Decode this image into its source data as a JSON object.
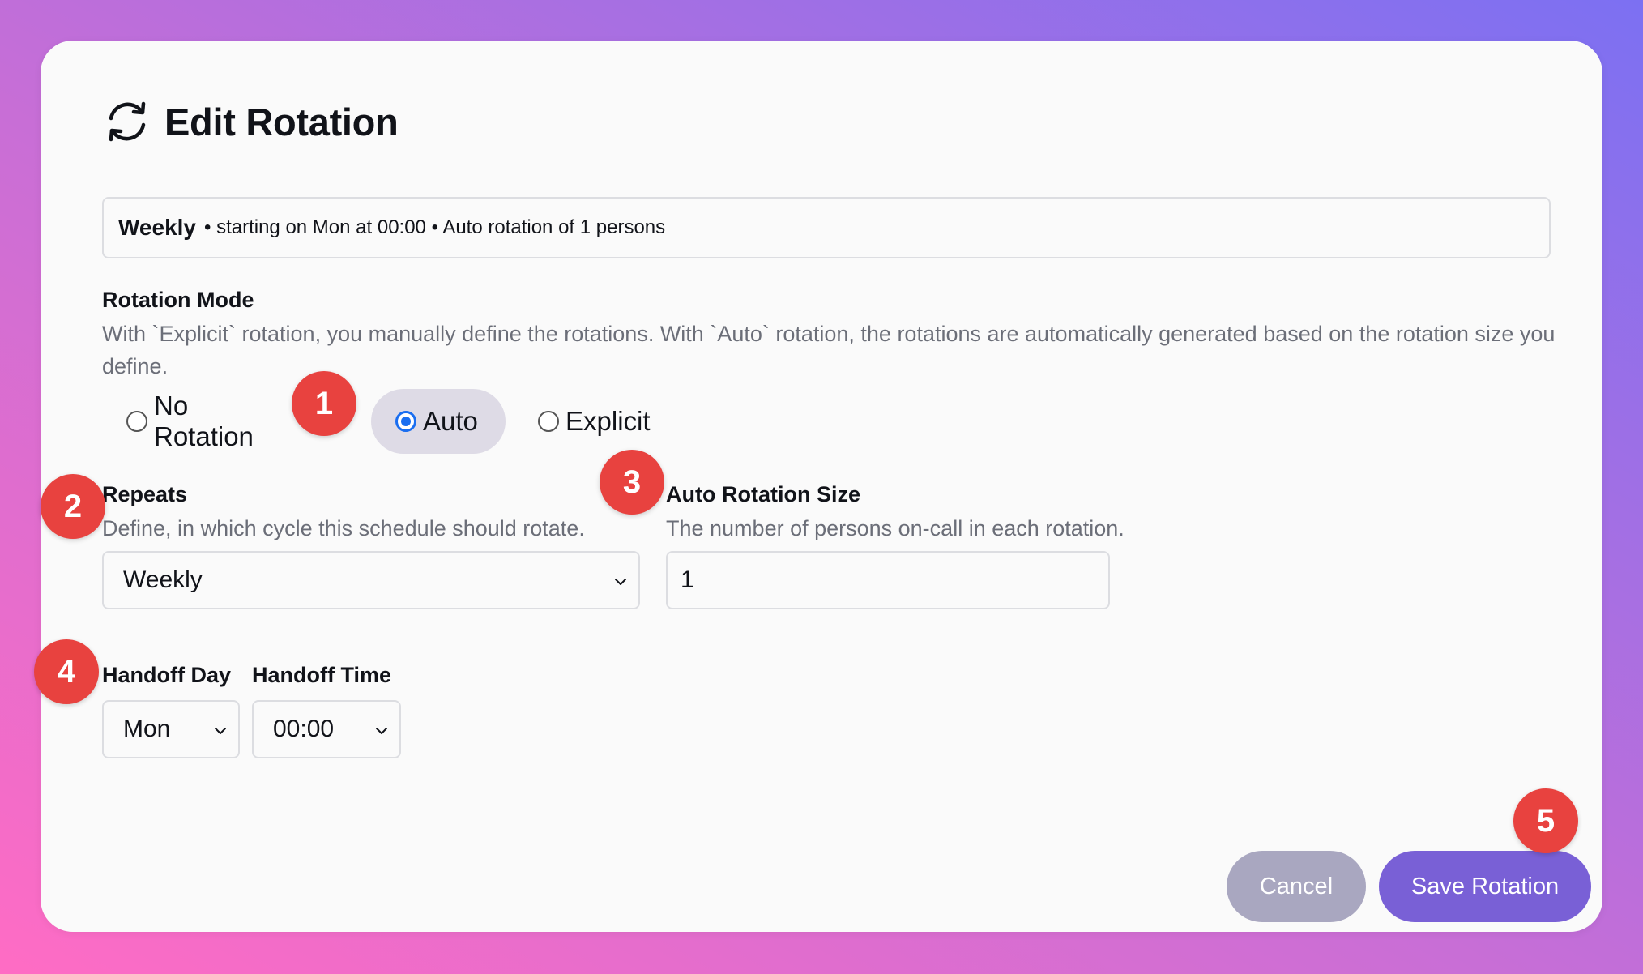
{
  "dialog": {
    "title": "Edit Rotation",
    "icon": "refresh-icon"
  },
  "summary": {
    "frequency": "Weekly",
    "details": "• starting on Mon at 00:00 • Auto rotation of 1 persons"
  },
  "rotation_mode": {
    "label": "Rotation Mode",
    "description": "With `Explicit` rotation, you manually define the rotations. With `Auto` rotation, the rotations are automatically generated based on the rotation size you define.",
    "options": [
      {
        "label": "No Rotation",
        "selected": false
      },
      {
        "label": "Auto",
        "selected": true
      },
      {
        "label": "Explicit",
        "selected": false
      }
    ]
  },
  "repeats": {
    "label": "Repeats",
    "description": "Define, in which cycle this schedule should rotate.",
    "value": "Weekly"
  },
  "auto_rotation_size": {
    "label": "Auto Rotation Size",
    "description": "The number of persons on-call in each rotation.",
    "value": "1"
  },
  "handoff_day": {
    "label": "Handoff Day",
    "value": "Mon"
  },
  "handoff_time": {
    "label": "Handoff Time",
    "value": "00:00"
  },
  "buttons": {
    "cancel": "Cancel",
    "save": "Save Rotation"
  },
  "badges": [
    "1",
    "2",
    "3",
    "4",
    "5"
  ],
  "colors": {
    "accent": "#7960d6",
    "cancel": "#a9a7c0",
    "badge": "#e8423f",
    "radio_checked": "#1a6ef0"
  }
}
